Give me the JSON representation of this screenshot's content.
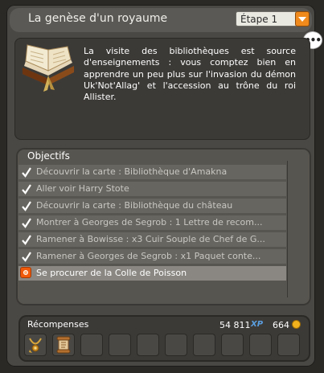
{
  "header": {
    "title": "La genèse d'un royaume",
    "step_selected": "Étape 1"
  },
  "description": "La visite des bibliothèques est source d'enseignements : vous comptez bien en apprendre un peu plus sur l'invasion du démon Uk'Not'Allag' et l'accession au trône du roi Allister.",
  "objectives": {
    "title": "Objectifs",
    "items": [
      {
        "label": "Découvrir la carte : Bibliothèque d'Amakna",
        "done": true
      },
      {
        "label": "Aller voir Harry Stote",
        "done": true
      },
      {
        "label": "Découvrir la carte : Bibliothèque du château",
        "done": true
      },
      {
        "label": "Montrer à Georges de Segrob : 1 Lettre de recom...",
        "done": true
      },
      {
        "label": "Ramener à Bowisse : x3 Cuir Souple de Chef de G...",
        "done": true
      },
      {
        "label": "Ramener à Georges de Segrob : x1 Paquet conte...",
        "done": true
      },
      {
        "label": "Se procurer de la Colle de Poisson",
        "done": false
      }
    ]
  },
  "rewards": {
    "title": "Récompenses",
    "xp": "54 811",
    "xp_unit": "XP",
    "kamas": "664",
    "slots": [
      "necklace-item-icon",
      "scroll-item-icon",
      "",
      "",
      "",
      "",
      "",
      "",
      "",
      "",
      ""
    ]
  },
  "colors": {
    "accent": "#f08a1c",
    "check": "#ffffff",
    "active_row": "#8a8782"
  }
}
